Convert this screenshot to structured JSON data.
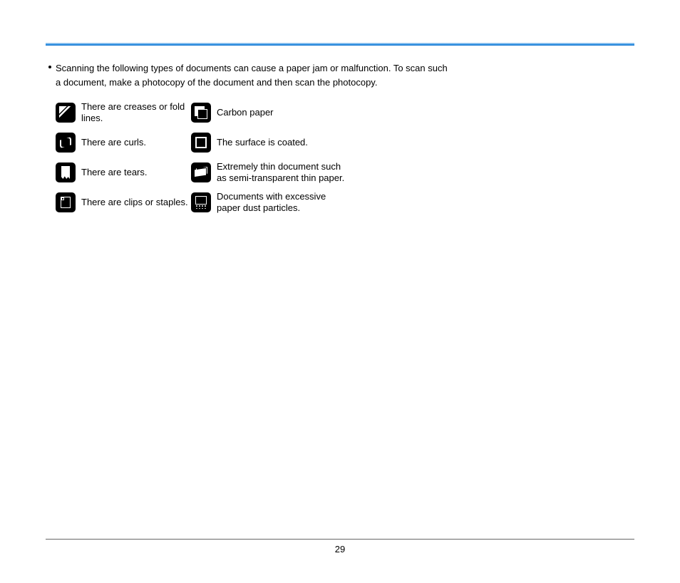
{
  "intro": "Scanning the following types of documents can cause a paper jam or malfunction. To scan such a document, make a photocopy of the document and then scan the photocopy.",
  "left": [
    {
      "icon": "crease-icon",
      "text": "There are creases or fold lines."
    },
    {
      "icon": "curl-icon",
      "text": "There are curls."
    },
    {
      "icon": "tear-icon",
      "text": "There are tears."
    },
    {
      "icon": "clip-icon",
      "text": "There are clips or staples."
    }
  ],
  "right": [
    {
      "icon": "carbon-icon",
      "text": "Carbon paper"
    },
    {
      "icon": "coated-icon",
      "text": "The surface is coated."
    },
    {
      "icon": "thin-icon",
      "text": "Extremely thin document such as semi-transparent thin paper."
    },
    {
      "icon": "dust-icon",
      "text": "Documents with excessive paper dust particles."
    }
  ],
  "page_number": "29"
}
